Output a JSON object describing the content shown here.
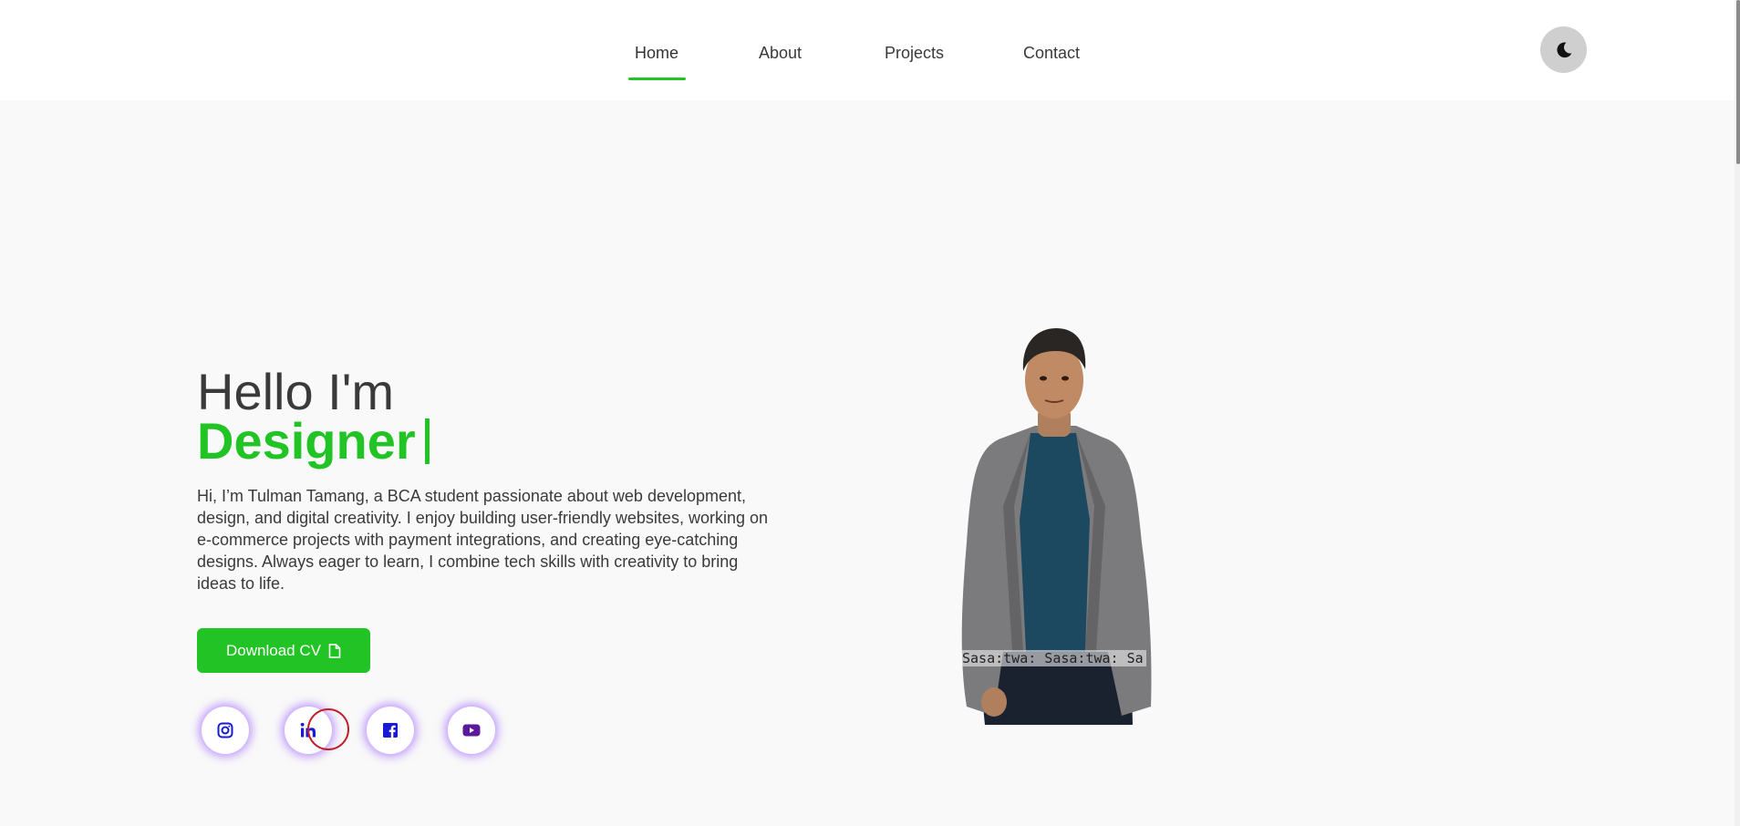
{
  "nav": {
    "items": [
      {
        "label": "Home",
        "active": true
      },
      {
        "label": "About",
        "active": false
      },
      {
        "label": "Projects",
        "active": false
      },
      {
        "label": "Contact",
        "active": false
      }
    ],
    "theme_toggle_icon": "moon-icon"
  },
  "hero": {
    "greeting": "Hello I'm",
    "role": "Designer",
    "description": "Hi, I’m Tulman Tamang, a BCA student passionate about web development, design, and digital creativity. I enjoy building user-friendly websites, working on e-commerce projects with payment integrations, and creating eye-catching designs. Always eager to learn, I combine tech skills with creativity to bring ideas to life.",
    "download_label": "Download CV",
    "download_icon": "file-icon",
    "photo_caption": "Sasa:twa: Sasa:twa: Sa"
  },
  "social": [
    {
      "name": "instagram-icon"
    },
    {
      "name": "linkedin-icon"
    },
    {
      "name": "facebook-icon"
    },
    {
      "name": "youtube-icon"
    }
  ],
  "colors": {
    "accent": "#22c425",
    "social_glow": "#8c46ff",
    "icon_blue": "#1a1ad6",
    "youtube_purple": "#5b1a9c"
  }
}
